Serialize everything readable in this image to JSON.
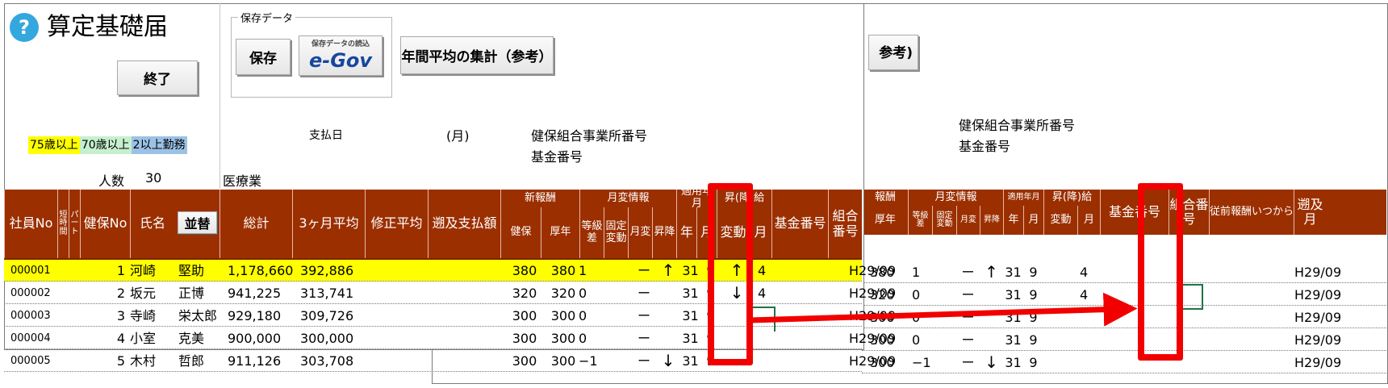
{
  "app": {
    "title": "算定基礎届",
    "help_icon": "?",
    "end_label": "終了"
  },
  "save_panel": {
    "legend": "保存データ",
    "save_label": "保存",
    "egov_caption": "保存データの読込",
    "egov_logo": "e-Gov"
  },
  "annual_avg_label": "年間平均の集計（参考）",
  "annual_avg_clipped": "参考)",
  "legend_items": [
    "75歳以上",
    "70歳以上",
    "2以上勤務"
  ],
  "colors": {
    "over75": "#ffff00",
    "over70": "#c6efce",
    "multi": "#9bc2e6",
    "header": "#9b2f00",
    "highlight": "#f20000",
    "icon": "#35a7df"
  },
  "headcount": {
    "label": "人数",
    "value": "30"
  },
  "industry": "医療業",
  "payday_label": "支払日",
  "month_label": "(月)",
  "union_office_label": "健保組合事業所番号",
  "fund_no_label": "基金番号",
  "headers": {
    "employee_no": "社員No",
    "short_hours": "短時間",
    "part": "パート",
    "ins_no": "健保No",
    "name": "氏名",
    "sort": "並替",
    "total": "総計",
    "avg3": "3ヶ月平均",
    "corrected_avg": "修正平均",
    "retro_pay": "遡及支払額",
    "new_pay": "新報酬",
    "new_pay_clipped": "報酬",
    "health": "健保",
    "pension": "厚年",
    "change_info": "月変情報",
    "grade_diff": "等級差",
    "fixed_change": "固定変動",
    "monthly": "月変",
    "updown": "昇降",
    "apply_ym": "適用年月",
    "year": "年",
    "month": "月",
    "raise_group": "昇(降)給",
    "change": "変動",
    "fund_no": "基金番号",
    "union_no": "組合番号",
    "prev_since": "従前報酬いつから",
    "retro_month": "遡及月"
  },
  "rows": [
    {
      "no": "000001",
      "idx": "1",
      "surname": "河崎",
      "given": "堅助",
      "total": "1,178,660",
      "avg3": "392,886",
      "health": "380",
      "pension": "380",
      "grade": "1",
      "fixed": "",
      "monthly": "ー",
      "updown": "↑",
      "year": "31",
      "month": "9",
      "change": "↑",
      "rmonth": "4",
      "prev": "H29/09"
    },
    {
      "no": "000002",
      "idx": "2",
      "surname": "坂元",
      "given": "正博",
      "total": "941,225",
      "avg3": "313,741",
      "health": "320",
      "pension": "320",
      "grade": "0",
      "fixed": "",
      "monthly": "ー",
      "updown": "",
      "year": "31",
      "month": "9",
      "change": "↓",
      "rmonth": "4",
      "prev": "H29/09"
    },
    {
      "no": "000003",
      "idx": "3",
      "surname": "寺崎",
      "given": "栄太郎",
      "total": "929,180",
      "avg3": "309,726",
      "health": "300",
      "pension": "300",
      "grade": "0",
      "fixed": "",
      "monthly": "ー",
      "updown": "",
      "year": "31",
      "month": "9",
      "change": "",
      "rmonth": "",
      "prev": "H29/09"
    },
    {
      "no": "000004",
      "idx": "4",
      "surname": "小室",
      "given": "克美",
      "total": "900,000",
      "avg3": "300,000",
      "health": "300",
      "pension": "300",
      "grade": "0",
      "fixed": "",
      "monthly": "ー",
      "updown": "",
      "year": "31",
      "month": "9",
      "change": "",
      "rmonth": "",
      "prev": "H29/09"
    },
    {
      "no": "000005",
      "idx": "5",
      "surname": "木村",
      "given": "哲郎",
      "total": "911,126",
      "avg3": "303,708",
      "health": "300",
      "pension": "300",
      "grade": "−1",
      "fixed": "",
      "monthly": "ー",
      "updown": "↓",
      "year": "31",
      "month": "9",
      "change": "",
      "rmonth": "",
      "prev": "H29/09"
    }
  ],
  "after_rows": [
    {
      "pension": "380",
      "grade": "1",
      "monthly": "ー",
      "updown": "↑",
      "year": "31",
      "month": "9",
      "change": "",
      "rmonth": "4",
      "prev": "H29/09"
    },
    {
      "pension": "320",
      "grade": "0",
      "monthly": "ー",
      "updown": "",
      "year": "31",
      "month": "9",
      "change": "",
      "rmonth": "4",
      "prev": "H29/09"
    },
    {
      "pension": "300",
      "grade": "0",
      "monthly": "ー",
      "updown": "",
      "year": "31",
      "month": "9",
      "change": "",
      "rmonth": "",
      "prev": "H29/09"
    },
    {
      "pension": "300",
      "grade": "0",
      "monthly": "ー",
      "updown": "",
      "year": "31",
      "month": "9",
      "change": "",
      "rmonth": "",
      "prev": "H29/09"
    },
    {
      "pension": "300",
      "grade": "−1",
      "monthly": "ー",
      "updown": "↓",
      "year": "31",
      "month": "9",
      "change": "",
      "rmonth": "",
      "prev": "H29/09"
    }
  ]
}
